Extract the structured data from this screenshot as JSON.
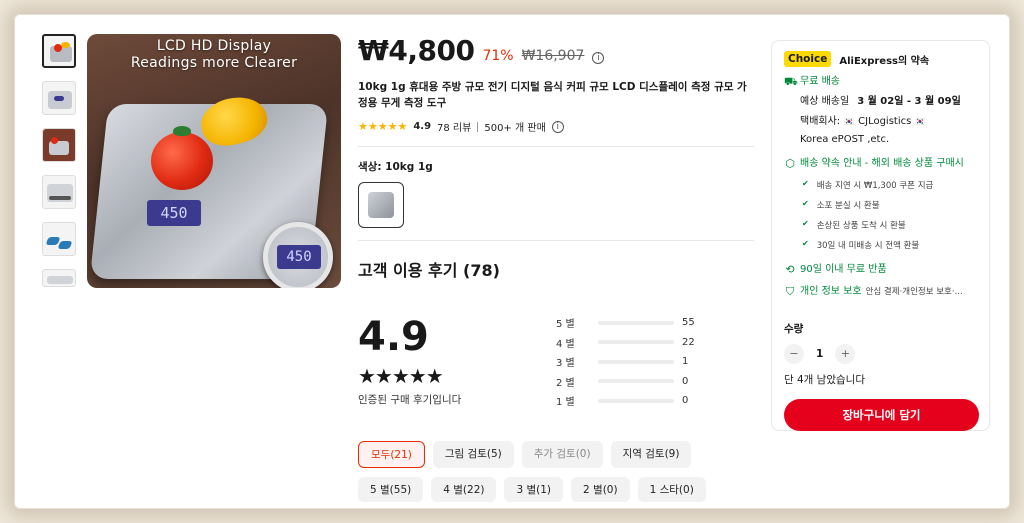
{
  "gallery": {
    "caption_line1": "LCD HD Display",
    "caption_line2": "Readings more Clearer",
    "lcd_reading": "450",
    "loupe_reading": "450"
  },
  "product": {
    "price": "₩4,800",
    "discount": "71%",
    "original_price": "₩16,907",
    "title": "10kg 1g 휴대용 주방 규모 전기 디지털 음식 커피 규모 LCD 디스플레이 측정 규모 가정용 무게 측정 도구",
    "rating": "4.9",
    "reviews_count": "78 리뷰",
    "sold": "500+ 개 판매",
    "color_label": "색상: 10kg 1g"
  },
  "reviews": {
    "heading": "고객 이용 후기 (78)",
    "score": "4.9",
    "stars_display": "★★★★★",
    "verified_note": "인증된 구매 후기입니다",
    "distribution": [
      {
        "label": "5 별",
        "count": "55",
        "fraction": 0.705
      },
      {
        "label": "4 별",
        "count": "22",
        "fraction": 0.282
      },
      {
        "label": "3 별",
        "count": "1",
        "fraction": 0.013
      },
      {
        "label": "2 별",
        "count": "0",
        "fraction": 0
      },
      {
        "label": "1 별",
        "count": "0",
        "fraction": 0
      }
    ],
    "filters_row1": [
      "모두(21)",
      "그림 검토(5)",
      "추가 검토(0)",
      "지역 검토(9)"
    ],
    "filters_row2": [
      "5 별(55)",
      "4 별(22)",
      "3 별(1)",
      "2 별(0)",
      "1 스타(0)"
    ]
  },
  "panel": {
    "choice_badge": "Choice",
    "choice_title": "AliExpress의 약속",
    "free_shipping": "무료 배송",
    "delivery_label": "예상 배송일",
    "delivery_dates": "3 월 02일 - 3 월 09일",
    "carrier_label": "택배회사:",
    "carrier_value": "CJLogistics",
    "carrier_value2": "Korea ePOST ,etc.",
    "delivery_promise": "배송 약속 안내 - 해외 배송 상품 구매시",
    "promises": [
      "배송 지연 시 ₩1,300 쿠폰 지급",
      "소포 분실 시 환불",
      "손상된 상품 도착 시 환불",
      "30일 내 미배송 시 전액 환불"
    ],
    "returns": "90일 이내 무료 반품",
    "privacy_title": "개인 정보 보호",
    "privacy_text": "안심 결제·개인정보 보호·...",
    "qty_label": "수량",
    "qty_value": "1",
    "qty_minus": "−",
    "qty_plus": "+",
    "stock_note": "단 4개 남았습니다",
    "cart_button": "장바구니에 담기"
  },
  "colors": {
    "accent_red": "#e62e04",
    "cart_red": "#e5001c",
    "choice_yellow": "#fdd902",
    "green": "#00883a"
  }
}
